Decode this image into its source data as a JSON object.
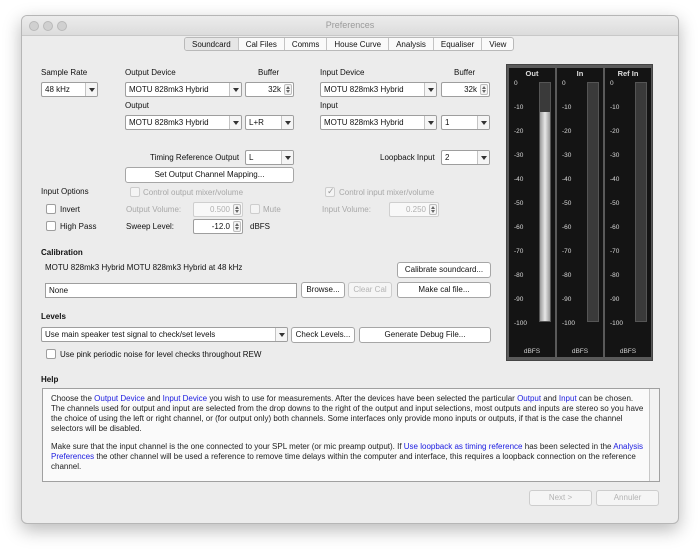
{
  "window": {
    "title": "Preferences"
  },
  "tabs": [
    "Soundcard",
    "Cal Files",
    "Comms",
    "House Curve",
    "Analysis",
    "Equaliser",
    "View"
  ],
  "sample_rate": {
    "label": "Sample Rate",
    "value": "48 kHz"
  },
  "output_device": {
    "label": "Output Device",
    "value": "MOTU 828mk3 Hybrid",
    "buffer_label": "Buffer",
    "buffer_value": "32k",
    "output_label": "Output",
    "output_device_value": "MOTU 828mk3 Hybrid",
    "channel": "L+R"
  },
  "input_device": {
    "label": "Input Device",
    "value": "MOTU 828mk3 Hybrid",
    "buffer_label": "Buffer",
    "buffer_value": "32k",
    "input_label": "Input",
    "input_device_value": "MOTU 828mk3 Hybrid",
    "channel": "1"
  },
  "timing": {
    "label": "Timing Reference Output",
    "value": "L",
    "set_button": "Set Output Channel Mapping..."
  },
  "loopback": {
    "label": "Loopback Input",
    "value": "2"
  },
  "input_options": {
    "label": "Input Options",
    "invert": "Invert",
    "high_pass": "High Pass"
  },
  "output_mixer": {
    "label": "Control output mixer/volume",
    "volume_label": "Output Volume:",
    "volume_value": "0.500",
    "mute": "Mute"
  },
  "input_mixer": {
    "label": "Control input mixer/volume",
    "volume_label": "Input Volume:",
    "volume_value": "0.250"
  },
  "sweep": {
    "label": "Sweep Level:",
    "value": "-12.0",
    "unit": "dBFS"
  },
  "calibration": {
    "title": "Calibration",
    "device_text": "MOTU 828mk3 Hybrid MOTU 828mk3 Hybrid at 48 kHz",
    "calibrate_button": "Calibrate soundcard...",
    "file_value": "None",
    "browse": "Browse...",
    "clear": "Clear Cal",
    "make": "Make cal file..."
  },
  "levels": {
    "title": "Levels",
    "select_value": "Use main speaker test signal to check/set levels",
    "check_button": "Check Levels...",
    "debug_button": "Generate Debug File...",
    "pink_noise": "Use pink periodic noise for level checks throughout REW"
  },
  "meters": {
    "ticks": [
      "0",
      "-10",
      "-20",
      "-30",
      "-40",
      "-50",
      "-60",
      "-70",
      "-80",
      "-90",
      "-100"
    ],
    "unit": "dBFS",
    "channels": [
      {
        "name": "Out",
        "level_db": -12
      },
      {
        "name": "In",
        "level_db": -100
      },
      {
        "name": "Ref In",
        "level_db": -100
      }
    ]
  },
  "help": {
    "title": "Help",
    "p1": [
      {
        "t": "Choose the "
      },
      {
        "t": "Output Device",
        "link": true
      },
      {
        "t": " and "
      },
      {
        "t": "Input Device",
        "link": true
      },
      {
        "t": " you wish to use for measurements. After the devices have been selected the particular "
      },
      {
        "t": "Output",
        "link": true
      },
      {
        "t": " and "
      },
      {
        "t": "Input",
        "link": true
      },
      {
        "t": " can be chosen. The channels used for output and input are selected from the drop downs to the right of the output and input selections, most outputs and inputs are stereo so you have the choice of using the left or right channel, or (for output only) both channels. Some interfaces only provide mono inputs or outputs, if that is the case the channel selectors will be disabled."
      }
    ],
    "p2": [
      {
        "t": "Make sure that the input channel is the one connected to your SPL meter (or mic preamp output). If "
      },
      {
        "t": "Use loopback as timing reference",
        "link": true
      },
      {
        "t": " has been selected in the "
      },
      {
        "t": "Analysis Preferences",
        "link": true
      },
      {
        "t": " the other channel will be used a reference to remove time delays within the computer and interface, this requires a loopback connection on the reference channel."
      }
    ]
  },
  "footer": {
    "next": "Next >",
    "cancel": "Annuler"
  }
}
